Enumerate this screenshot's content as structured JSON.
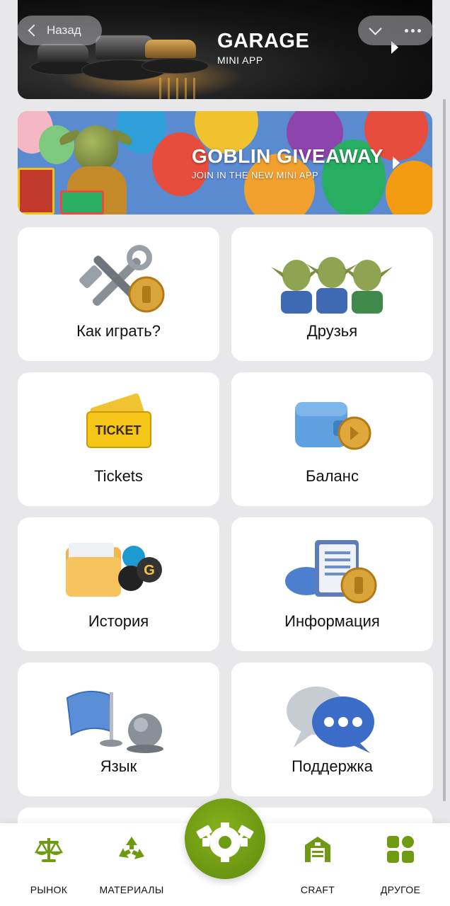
{
  "header": {
    "back_label": "Назад",
    "back_icon": "chevron-left-icon",
    "collapse_icon": "chevron-down-icon",
    "more_icon": "more-dots-icon"
  },
  "banners": {
    "garage": {
      "title": "GARAGE",
      "subtitle": "MINI APP"
    },
    "giveaway": {
      "title": "GOBLIN GIVEAWAY",
      "subtitle": "JOIN IN THE NEW MINI APP"
    }
  },
  "cards": [
    {
      "label": "Как играть?",
      "icon": "tools-coin-icon"
    },
    {
      "label": "Друзья",
      "icon": "goblin-friends-icon"
    },
    {
      "label": "Tickets",
      "icon": "ticket-icon",
      "icon_text": "TICKET"
    },
    {
      "label": "Баланс",
      "icon": "wallet-icon"
    },
    {
      "label": "История",
      "icon": "folder-history-icon",
      "icon_text": "G"
    },
    {
      "label": "Информация",
      "icon": "info-document-icon"
    },
    {
      "label": "Язык",
      "icon": "flag-globe-icon"
    },
    {
      "label": "Поддержка",
      "icon": "chat-bubbles-icon"
    }
  ],
  "bottom_nav": [
    {
      "label": "РЫНОК",
      "icon": "scales-icon"
    },
    {
      "label": "МАТЕРИАЛЫ",
      "icon": "recycle-icon"
    },
    {
      "label": "",
      "icon": "craft-gear-hammers-icon"
    },
    {
      "label": "CRAFT",
      "icon": "warehouse-icon"
    },
    {
      "label": "ДРУГОЕ",
      "icon": "apps-grid-icon"
    }
  ],
  "colors": {
    "accent_green": "#6e9b12",
    "background": "#e8e8ea",
    "card": "#ffffff"
  }
}
